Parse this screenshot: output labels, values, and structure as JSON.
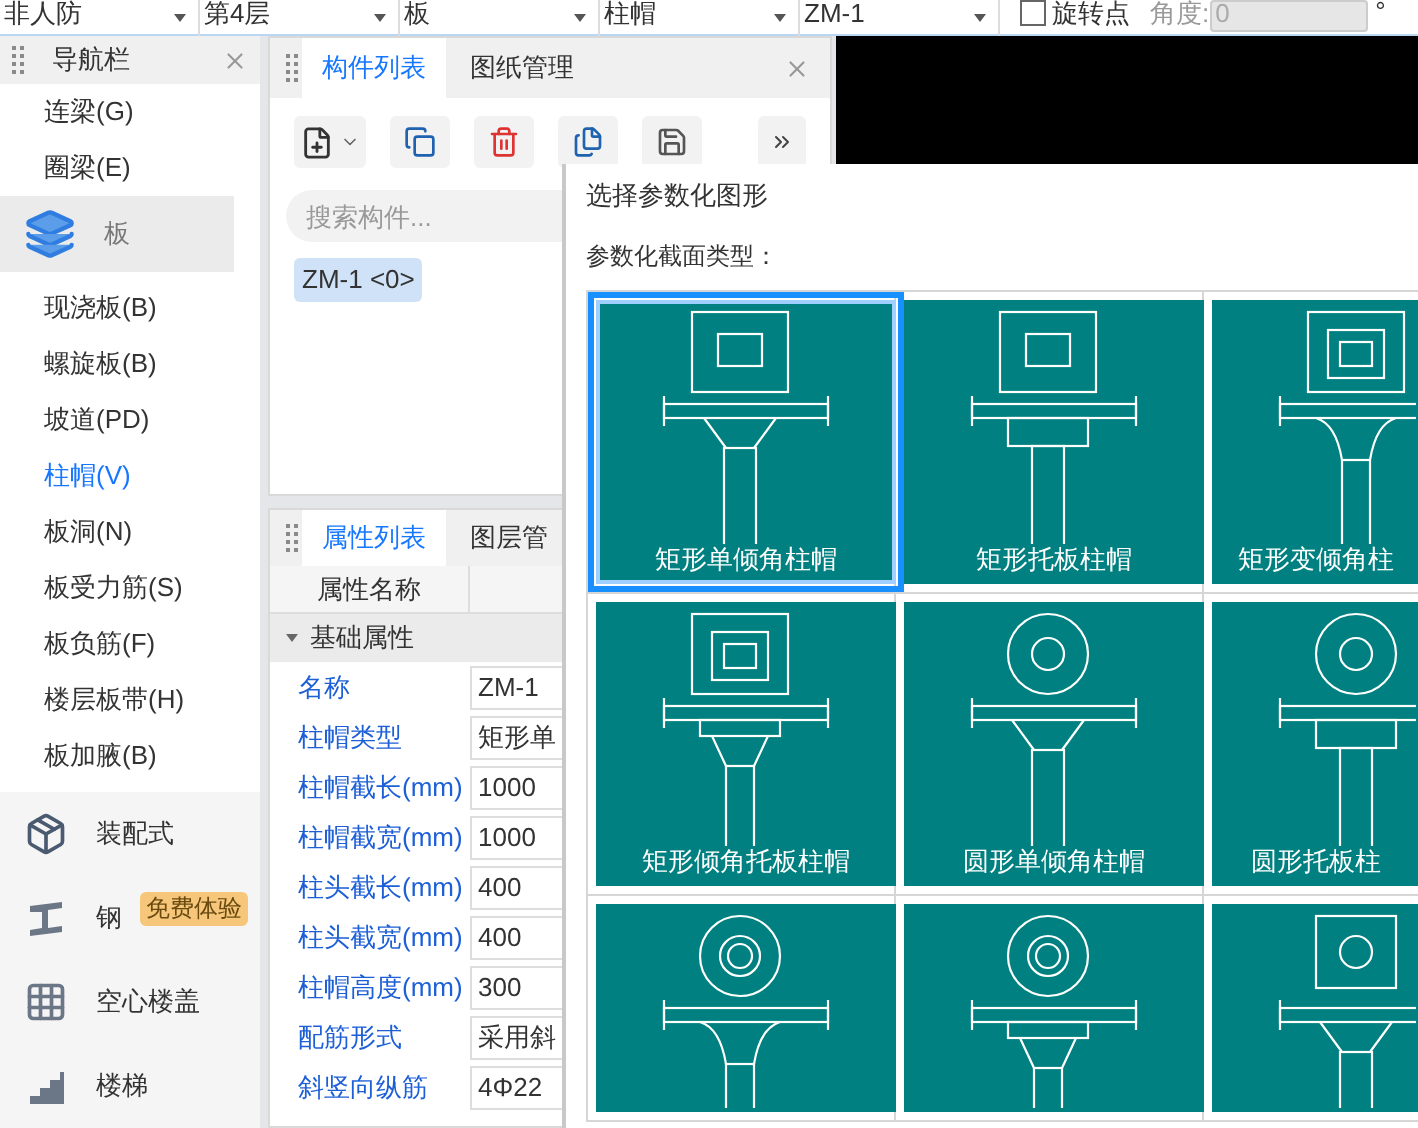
{
  "toolbar": {
    "dropdowns": [
      "非人防",
      "第4层",
      "板",
      "柱帽",
      "ZM-1"
    ],
    "rotate_point": {
      "label": "旋转点",
      "checked": false
    },
    "angle": {
      "label": "角度:",
      "value": "0",
      "disabled": true,
      "unit": "°"
    }
  },
  "navigator": {
    "title": "导航栏",
    "items": [
      {
        "label": "连梁(G)",
        "selected": false
      },
      {
        "label": "圈梁(E)",
        "selected": false
      }
    ],
    "groups": [
      {
        "label": "板",
        "selected": true,
        "children": [
          {
            "label": "现浇板(B)",
            "selected": false
          },
          {
            "label": "螺旋板(B)",
            "selected": false
          },
          {
            "label": "坡道(PD)",
            "selected": false
          },
          {
            "label": "柱帽(V)",
            "selected": true
          },
          {
            "label": "板洞(N)",
            "selected": false
          },
          {
            "label": "板受力筋(S)",
            "selected": false
          },
          {
            "label": "板负筋(F)",
            "selected": false
          },
          {
            "label": "楼层板带(H)",
            "selected": false
          },
          {
            "label": "板加腋(B)",
            "selected": false
          }
        ]
      },
      {
        "label": "装配式",
        "selected": false
      },
      {
        "label": "钢",
        "selected": false,
        "badge": "免费体验"
      },
      {
        "label": "空心楼盖",
        "selected": false
      },
      {
        "label": "楼梯",
        "selected": false
      }
    ]
  },
  "component_panel": {
    "tabs": [
      {
        "label": "构件列表",
        "selected": true
      },
      {
        "label": "图纸管理",
        "selected": false
      }
    ],
    "search": {
      "placeholder": "搜索构件..."
    },
    "components": [
      {
        "label": "ZM-1 <0>",
        "selected": true
      }
    ]
  },
  "property_panel": {
    "tabs": [
      {
        "label": "属性列表",
        "selected": true
      },
      {
        "label": "图层管",
        "selected": false
      }
    ],
    "column_1": "属性名称",
    "section": {
      "label": "基础属性",
      "rows": [
        {
          "name": "名称",
          "value": "ZM-1"
        },
        {
          "name": "柱帽类型",
          "value": "矩形单"
        },
        {
          "name": "柱帽截长(mm)",
          "value": "1000"
        },
        {
          "name": "柱帽截宽(mm)",
          "value": "1000"
        },
        {
          "name": "柱头截长(mm)",
          "value": "400"
        },
        {
          "name": "柱头截宽(mm)",
          "value": "400"
        },
        {
          "name": "柱帽高度(mm)",
          "value": "300"
        },
        {
          "name": "配筋形式",
          "value": "采用斜"
        },
        {
          "name": "斜竖向纵筋",
          "value": "4Φ22"
        }
      ]
    }
  },
  "dialog": {
    "title": "选择参数化图形",
    "section_label": "参数化截面类型：",
    "options": [
      {
        "label": "矩形单倾角柱帽",
        "kind": "rect_taper",
        "selected": true
      },
      {
        "label": "矩形托板柱帽",
        "kind": "rect_plate",
        "selected": false
      },
      {
        "label": "矩形变倾角柱",
        "kind": "rect_curve",
        "selected": false
      },
      {
        "label": "矩形倾角托板柱帽",
        "kind": "rect_platetaper",
        "selected": false
      },
      {
        "label": "圆形单倾角柱帽",
        "kind": "round_taper",
        "selected": false
      },
      {
        "label": "圆形托板柱",
        "kind": "round_plate",
        "selected": false
      },
      {
        "kind": "round_curve",
        "selected": false
      },
      {
        "kind": "round_platetaper",
        "selected": false
      },
      {
        "kind": "rectround_taper",
        "selected": false
      }
    ]
  }
}
